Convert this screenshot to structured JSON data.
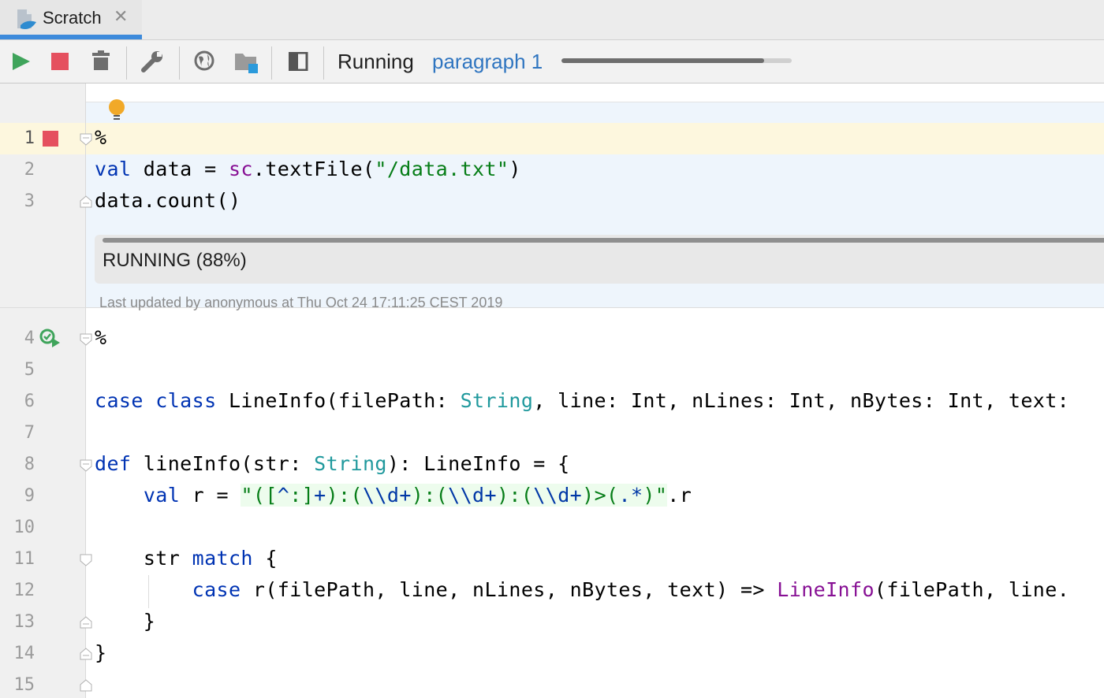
{
  "tab": {
    "label": "Scratch",
    "icon": "scala-file-icon",
    "close_icon": "close-icon"
  },
  "toolbar": {
    "buttons": [
      "run-icon",
      "stop-icon",
      "delete-icon",
      "settings-wrench-icon",
      "globe-icon",
      "folder-icon",
      "panel-icon"
    ],
    "status": "Running",
    "paragraph_label": "paragraph 1",
    "progress": 0.88
  },
  "editor": {
    "line_numbers": [
      "1",
      "2",
      "3",
      "4",
      "5",
      "6",
      "7",
      "8",
      "9",
      "10",
      "11",
      "12",
      "13",
      "14",
      "15"
    ],
    "paragraph1": {
      "line1": "%",
      "line2": {
        "kw": "val",
        "a": " data = ",
        "sc": "sc",
        "b": ".textFile(",
        "str": "\"/data.txt\"",
        "c": ")"
      },
      "line3": "data.count()",
      "output": "RUNNING (88%)",
      "updated": "Last updated by anonymous at Thu Oct 24 17:11:25 CEST 2019"
    },
    "paragraph2": {
      "line4": "%",
      "line6": {
        "kw1": "case",
        "kw2": "class",
        "a": " LineInfo(filePath: ",
        "t1": "String",
        "b": ", line: Int, nLines: Int, nBytes: Int, text:"
      },
      "line8": {
        "kw": "def",
        "a": " lineInfo(str: ",
        "t1": "String",
        "b": "): LineInfo = {"
      },
      "line9": {
        "indent": "    ",
        "kw": "val",
        "a": " r = ",
        "q1": "\"",
        "re": [
          "([",
          "^",
          ":]",
          "+",
          "):(",
          "\\\\d",
          "+",
          "):(",
          "\\\\d",
          "+",
          "):(",
          "\\\\d",
          "+",
          ")>(",
          ".",
          "*",
          ")"
        ],
        "q2": "\"",
        "b": ".r"
      },
      "line11": {
        "indent": "    ",
        "a": "str ",
        "kw": "match",
        "b": " {"
      },
      "line12": {
        "indent": "        ",
        "kw": "case",
        "a": " r(filePath, line, nLines, nBytes, text) => ",
        "fn": "LineInfo",
        "b": "(filePath, line."
      },
      "line13": "    }",
      "line14": "}"
    }
  },
  "colors": {
    "keyword": "#0033b3",
    "type": "#20999d",
    "string": "#067d17",
    "accent": "#3d8adb",
    "stop": "#e5505f",
    "run": "#3fa45b"
  }
}
